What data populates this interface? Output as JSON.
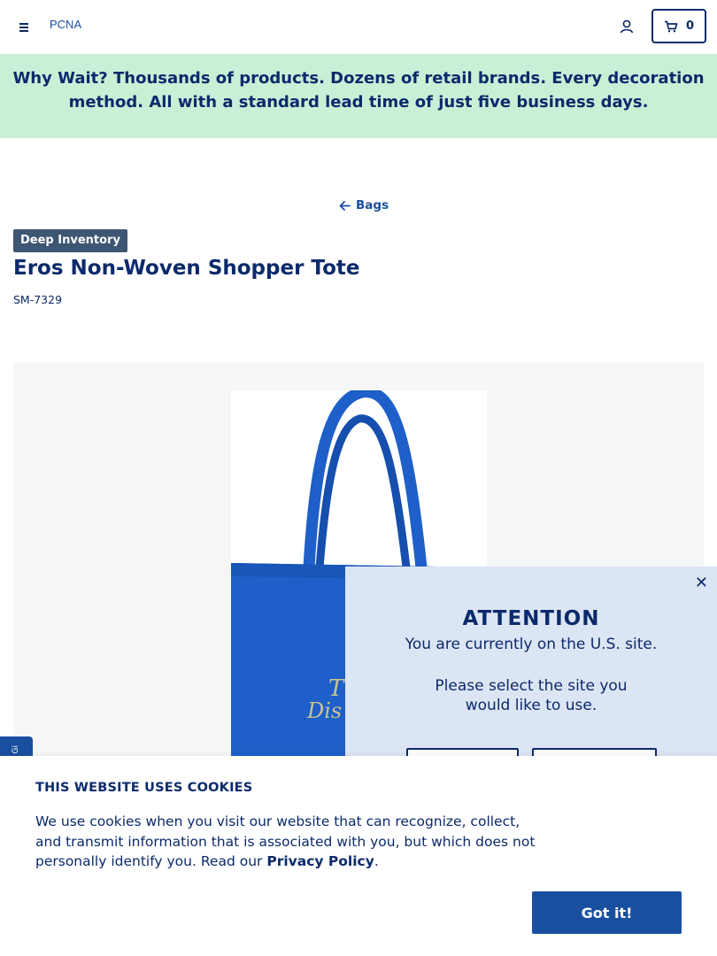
{
  "header": {
    "logo_alt": "PCNA",
    "cart_count": "0"
  },
  "promo": {
    "lead": "Why Wait?",
    "text": "Thousands of products. Dozens of retail brands. Every decoration method. All with a standard lead time of just five business days."
  },
  "product": {
    "back_label": "Bags",
    "badge": "Deep Inventory",
    "title": "Eros Non-Woven Shopper Tote",
    "sku": "SM-7329",
    "image_color": "#1e5fc9"
  },
  "side_tab": {
    "label": "Gi"
  },
  "attention": {
    "title": "ATTENTION",
    "line1": "You are currently on the U.S. site.",
    "line2": "Please select the site you would like to use."
  },
  "cookie": {
    "title": "THIS WEBSITE USES COOKIES",
    "text_before": "We use cookies when you visit our website that can recognize, collect, and transmit information that is associated with you, but which does not personally identify you. Read our ",
    "link": "Privacy Policy",
    "text_after": ".",
    "button": "Got it!"
  },
  "colors": {
    "navy": "#0b2a6b",
    "accent": "#1a4fa0",
    "promo_bg": "#c9f0d6",
    "modal_bg": "#dce5f3",
    "badge_bg": "#3d5673"
  }
}
